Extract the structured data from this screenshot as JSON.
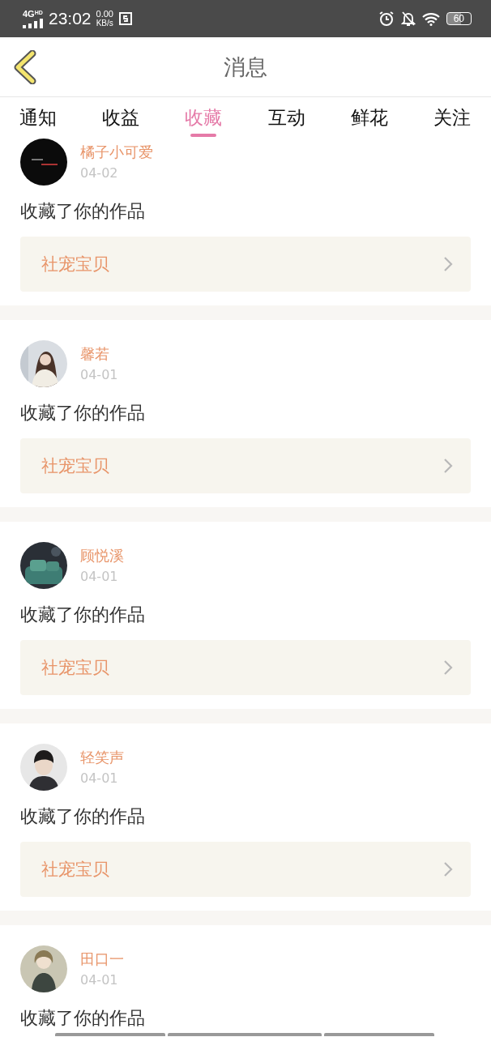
{
  "status_bar": {
    "network": "4G",
    "network_badge": "HD",
    "time": "23:02",
    "speed_value": "0.00",
    "speed_unit": "KB/s",
    "battery": "60"
  },
  "header": {
    "title": "消息"
  },
  "tabs": [
    {
      "label": "通知",
      "selected": false
    },
    {
      "label": "收益",
      "selected": false
    },
    {
      "label": "收藏",
      "selected": true
    },
    {
      "label": "互动",
      "selected": false
    },
    {
      "label": "鲜花",
      "selected": false
    },
    {
      "label": "关注",
      "selected": false
    }
  ],
  "items": [
    {
      "name": "橘子小可爱",
      "date": "04-02",
      "action": "收藏了你的作品",
      "work": "社宠宝贝"
    },
    {
      "name": "馨若",
      "date": "04-01",
      "action": "收藏了你的作品",
      "work": "社宠宝贝"
    },
    {
      "name": "顾悦溪",
      "date": "04-01",
      "action": "收藏了你的作品",
      "work": "社宠宝贝"
    },
    {
      "name": "轻笑声",
      "date": "04-01",
      "action": "收藏了你的作品",
      "work": "社宠宝贝"
    },
    {
      "name": "田口一",
      "date": "04-01",
      "action": "收藏了你的作品"
    }
  ]
}
